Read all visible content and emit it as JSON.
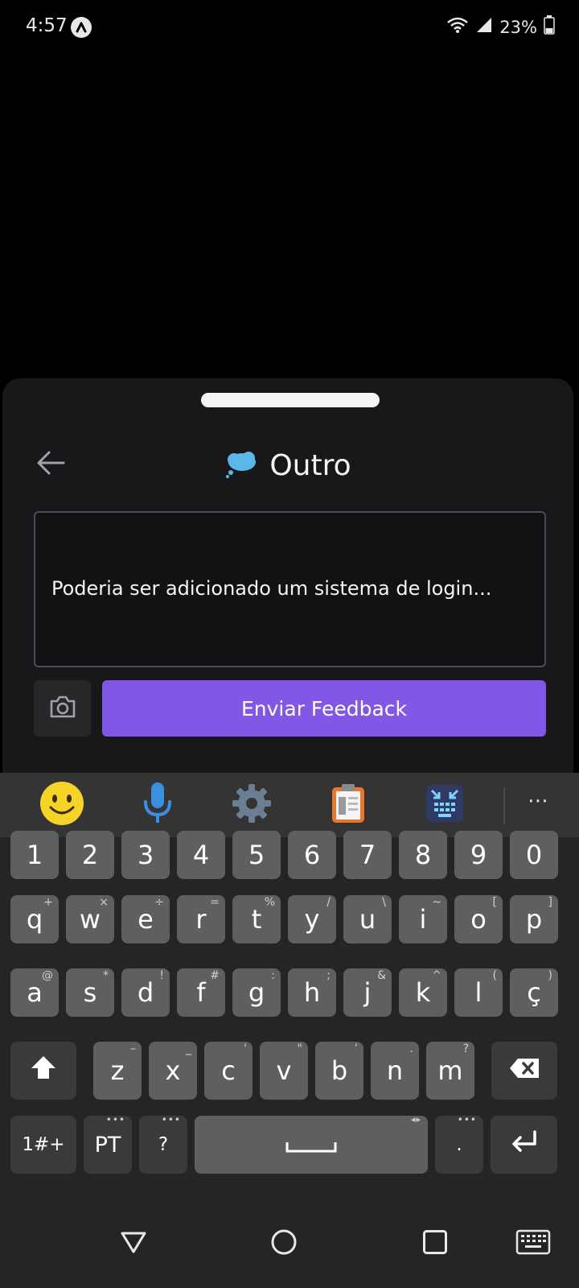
{
  "status_bar": {
    "time": "4:57",
    "battery": "23%"
  },
  "sheet": {
    "title": "Outro",
    "feedback_text": "Poderia ser adicionado um sistema de login...",
    "submit_label": "Enviar Feedback"
  },
  "keyboard": {
    "toolbar_more": "⋯",
    "number_row": [
      "1",
      "2",
      "3",
      "4",
      "5",
      "6",
      "7",
      "8",
      "9",
      "0"
    ],
    "row1": [
      {
        "k": "q",
        "s": "+"
      },
      {
        "k": "w",
        "s": "×"
      },
      {
        "k": "e",
        "s": "÷"
      },
      {
        "k": "r",
        "s": "="
      },
      {
        "k": "t",
        "s": "%"
      },
      {
        "k": "y",
        "s": "/"
      },
      {
        "k": "u",
        "s": "\\"
      },
      {
        "k": "i",
        "s": "~"
      },
      {
        "k": "o",
        "s": "["
      },
      {
        "k": "p",
        "s": "]"
      }
    ],
    "row2": [
      {
        "k": "a",
        "s": "@"
      },
      {
        "k": "s",
        "s": "*"
      },
      {
        "k": "d",
        "s": "!"
      },
      {
        "k": "f",
        "s": "#"
      },
      {
        "k": "g",
        "s": ":"
      },
      {
        "k": "h",
        "s": ";"
      },
      {
        "k": "j",
        "s": "&"
      },
      {
        "k": "k",
        "s": "^"
      },
      {
        "k": "l",
        "s": "("
      },
      {
        "k": "ç",
        "s": ")"
      }
    ],
    "row3": [
      {
        "k": "z",
        "s": "–"
      },
      {
        "k": "x",
        "s": "_"
      },
      {
        "k": "c",
        "s": "'"
      },
      {
        "k": "v",
        "s": "\""
      },
      {
        "k": "b",
        "s": "’"
      },
      {
        "k": "n",
        "s": "."
      },
      {
        "k": "m",
        "s": "?"
      }
    ],
    "symbols_label": "1#+",
    "language_label": "PT",
    "question_label": "?",
    "period_label": ".",
    "space_arrows": "◂▸"
  },
  "colors": {
    "accent": "#8257e5",
    "sheet_bg": "#18181b"
  },
  "icons": {
    "back": "arrow-left-icon",
    "title": "thought-bubble-icon",
    "camera": "camera-icon",
    "emoji": "emoji-icon",
    "mic": "microphone-icon",
    "settings": "gear-icon",
    "clipboard": "clipboard-icon",
    "resize": "keyboard-resize-icon"
  }
}
